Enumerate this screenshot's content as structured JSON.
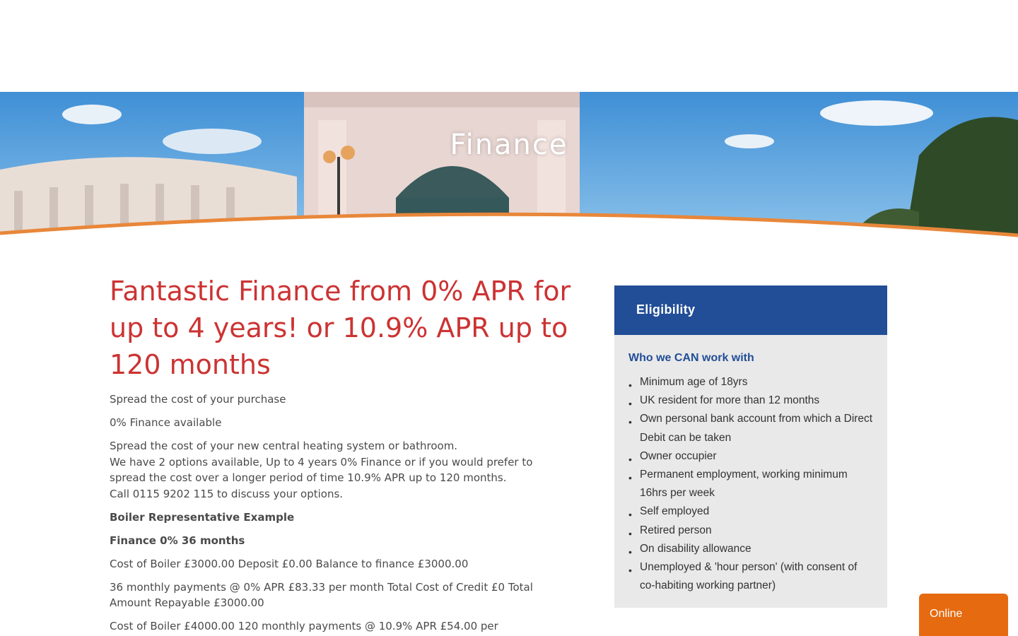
{
  "hero": {
    "title": "Finance"
  },
  "main": {
    "headline": "Fantastic Finance from 0% APR for up to 4 years! or 10.9% APR up to 120 months",
    "intro": "Spread the cost of your purchase",
    "available": "0% Finance available",
    "desc_line1": "Spread the cost of your new central heating system or bathroom.",
    "desc_line2": "We have 2 options available, Up to 4 years 0% Finance or if you would prefer to spread the cost over a longer period of time 10.9% APR up to 120 months.",
    "desc_line3": "Call 0115 9202 115 to discuss your options.",
    "example_heading": "Boiler Representative Example",
    "finance_heading": "Finance 0% 36 months",
    "example1": "Cost of Boiler £3000.00 Deposit £0.00 Balance to finance £3000.00",
    "example2": "36 monthly payments @ 0% APR £83.33 per month Total Cost of Credit £0 Total Amount Repayable £3000.00",
    "example3": "Cost of Boiler £4000.00 120 monthly payments @ 10.9% APR £54.00 per"
  },
  "eligibility": {
    "title": "Eligibility",
    "subtitle": "Who we CAN work with",
    "items": [
      "Minimum age of 18yrs",
      "UK resident for more than 12 months",
      "Own personal bank account from which a Direct Debit can be taken",
      "Owner occupier",
      "Permanent employment, working minimum 16hrs per week",
      "Self employed",
      "Retired person",
      "On disability allowance",
      "Unemployed & 'hour person' (with consent of co-habiting working partner)"
    ]
  },
  "chat": {
    "label": "Online"
  },
  "colors": {
    "headline": "#cc3333",
    "eligibility_header": "#224e97",
    "accent_orange": "#e56a10"
  }
}
